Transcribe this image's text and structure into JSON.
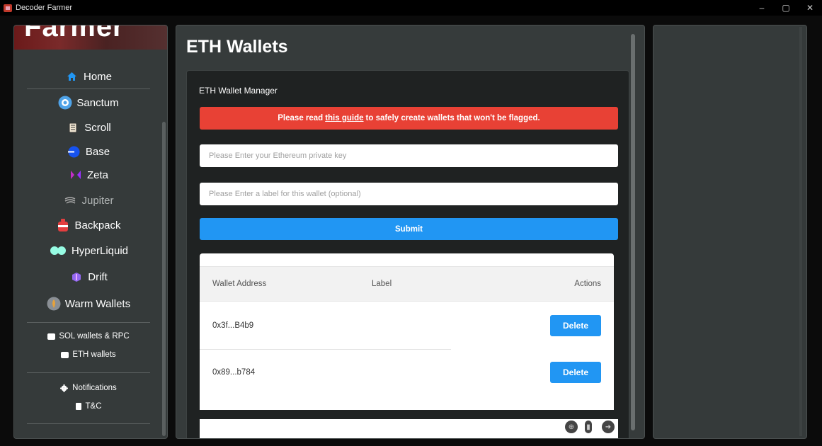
{
  "window": {
    "title": "Decoder Farmer",
    "controls": [
      "–",
      "▢",
      "✕"
    ]
  },
  "sidebar": {
    "banner_text": "Farmer",
    "items": [
      {
        "label": "Home",
        "icon": "home-icon"
      },
      {
        "label": "Sanctum",
        "icon": "sanctum-icon"
      },
      {
        "label": "Scroll",
        "icon": "scroll-icon"
      },
      {
        "label": "Base",
        "icon": "base-icon"
      },
      {
        "label": "Zeta",
        "icon": "zeta-icon"
      },
      {
        "label": "Jupiter",
        "icon": "jupiter-icon"
      },
      {
        "label": "Backpack",
        "icon": "backpack-icon"
      },
      {
        "label": "HyperLiquid",
        "icon": "hyperliquid-icon"
      },
      {
        "label": "Drift",
        "icon": "drift-icon"
      },
      {
        "label": "Warm Wallets",
        "icon": "warm-wallets-icon"
      }
    ],
    "wallet_links": [
      {
        "label": "SOL wallets & RPC"
      },
      {
        "label": "ETH wallets"
      }
    ],
    "footer_links": [
      {
        "label": "Notifications"
      },
      {
        "label": "T&C"
      }
    ]
  },
  "main": {
    "page_title": "ETH Wallets",
    "card_title": "ETH Wallet Manager",
    "alert": {
      "before": "Please read",
      "link": "this guide",
      "after": "to safely create wallets that won't be flagged."
    },
    "private_key_placeholder": "Please Enter your Ethereum private key",
    "label_placeholder": "Please Enter a label for this wallet (optional)",
    "submit_label": "Submit",
    "table": {
      "headers": [
        "Wallet Address",
        "Label",
        "Actions"
      ],
      "rows": [
        {
          "address": "0x3f...B4b9",
          "label": "",
          "action": "Delete"
        },
        {
          "address": "0x89...b784",
          "label": "",
          "action": "Delete"
        }
      ]
    }
  },
  "colors": {
    "alert": "#e84135",
    "primary": "#2196f3",
    "panel": "#363b3b"
  }
}
